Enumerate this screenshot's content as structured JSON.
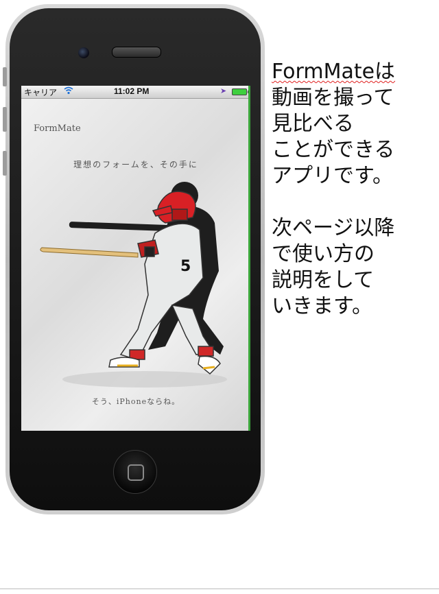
{
  "status_bar": {
    "carrier": "キャリア",
    "time": "11:02 PM",
    "wifi_icon": "wifi-icon",
    "location_icon": "location-arrow-icon",
    "battery_icon": "battery-icon"
  },
  "app_screen": {
    "logo": "FormMate",
    "tagline": "理想のフォームを、その手に",
    "bottom_tagline": "そう、iPhoneならね。",
    "illustration": "baseball-batter-with-shadow-illustration",
    "jersey_number": "5"
  },
  "description": {
    "lines": [
      "FormMateは",
      "動画を撮って",
      "見比べる",
      "ことができる",
      "アプリです。",
      "",
      "次ページ以降",
      "で使い方の",
      "説明をして",
      "いきます。"
    ]
  },
  "colors": {
    "screen_accent": "#3ba63b",
    "helmet": "#e0242a",
    "squiggle": "#e0201f"
  }
}
